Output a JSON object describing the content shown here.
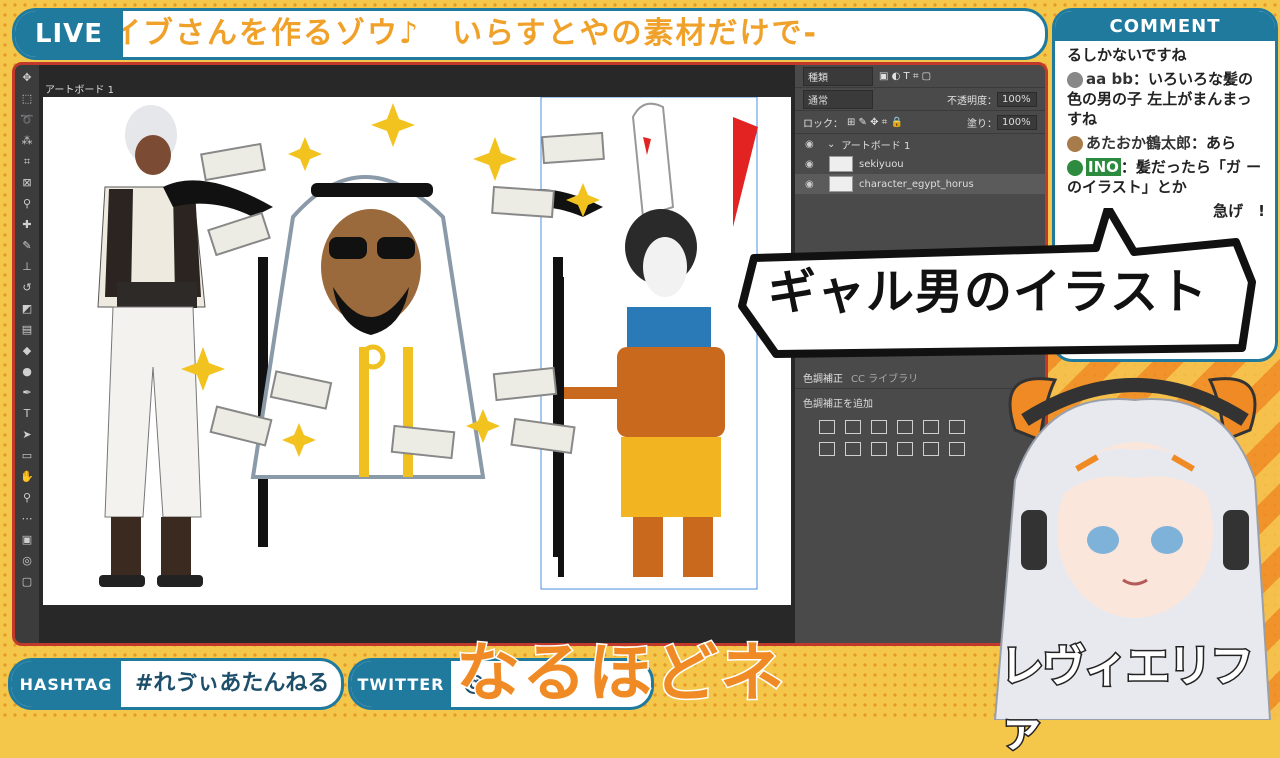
{
  "header": {
    "live_label": "LIVE",
    "title": "イブさんを作るゾウ♪　いらすとやの素材だけで-"
  },
  "comment_panel": {
    "title": "COMMENT",
    "comments": [
      {
        "name": "",
        "text": "るしかないですね"
      },
      {
        "name": "aa bb",
        "text": "いろいろな髪の色の男の子 左上がまんまっすね"
      },
      {
        "name": "あたおか鶴太郎",
        "text": "あら"
      },
      {
        "name": "INO",
        "text": "髪だったら「ガ ーのイラスト」とか"
      },
      {
        "name": "",
        "text": "急げ　!"
      }
    ]
  },
  "photoshop": {
    "artboard_label": "アートボード 1",
    "panel": {
      "kind_label": "種類",
      "blend_mode": "通常",
      "opacity_label": "不透明度：",
      "opacity_value": "100%",
      "lock_label": "ロック：",
      "fill_label": "塗り：",
      "fill_value": "100%",
      "group_label": "アートボード 1",
      "layers": [
        {
          "name": "sekiyuou",
          "selected": false
        },
        {
          "name": "character_egypt_horus",
          "selected": true
        }
      ],
      "adjust_tab": "色調補正",
      "library_tab": "CC ライブラリ",
      "adjust_add": "色調補正を追加"
    }
  },
  "speech_bubble": {
    "text": "ギャル男のイラスト"
  },
  "hashtag": {
    "label": "HASHTAG",
    "value": "#れゔぃあたんねる"
  },
  "twitter": {
    "label": "TWITTER",
    "value": "@"
  },
  "caption": "なるほどネ",
  "logo": "レヴィエリファ",
  "colors": {
    "accent": "#1f7a9e",
    "title_orange": "#f0a12a",
    "caption_orange": "#f08a24",
    "frame_red": "#c0392b"
  }
}
